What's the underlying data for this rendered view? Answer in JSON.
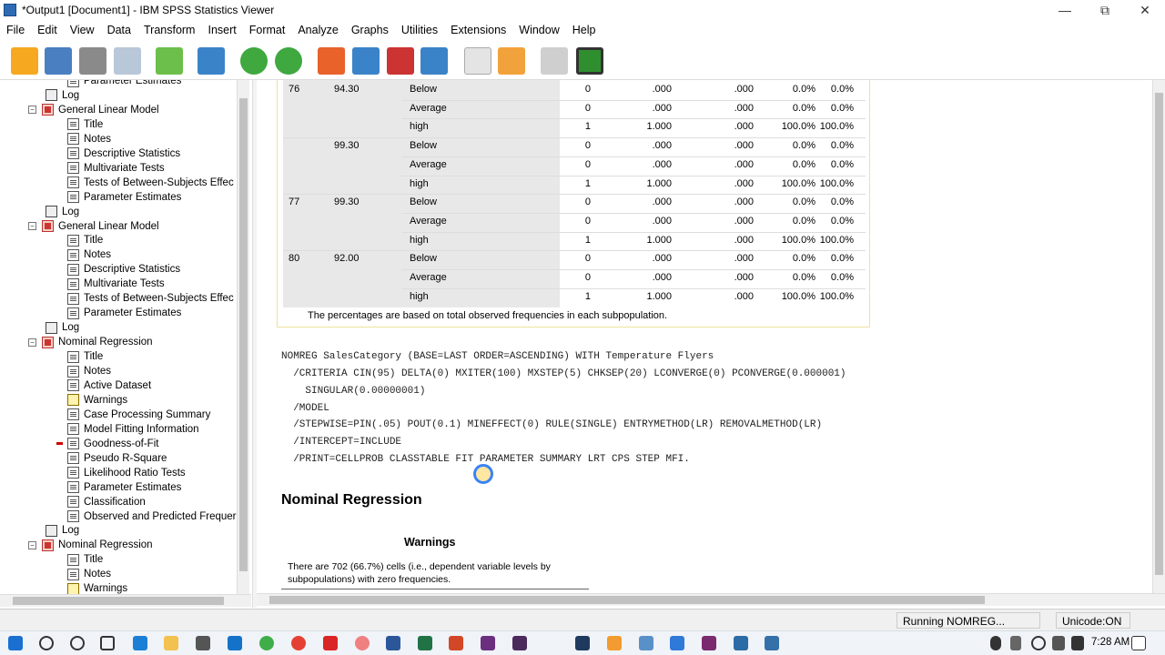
{
  "window": {
    "title": "*Output1 [Document1] - IBM SPSS Statistics Viewer",
    "minimize": "—",
    "restore": "⧉",
    "close": "✕"
  },
  "menu": [
    "File",
    "Edit",
    "View",
    "Data",
    "Transform",
    "Insert",
    "Format",
    "Analyze",
    "Graphs",
    "Utilities",
    "Extensions",
    "Window",
    "Help"
  ],
  "toolbar_icons": [
    "open-folder-icon",
    "save-icon",
    "print-icon",
    "print-preview-icon",
    "export-icon",
    "recall-dialog-icon",
    "undo-icon",
    "redo-icon",
    "goto-data-icon",
    "goto-case-icon",
    "goto-variable-icon",
    "variables-icon",
    "insert-output-icon",
    "insert-text-icon",
    "disabled-icon",
    "add-icon"
  ],
  "tree": [
    {
      "level": 2,
      "icon": "page",
      "label": "Parameter Estimates"
    },
    {
      "level": 1,
      "icon": "log",
      "label": "Log"
    },
    {
      "level": 1,
      "icon": "book",
      "label": "General Linear Model",
      "toggle": "−"
    },
    {
      "level": 2,
      "icon": "page",
      "label": "Title"
    },
    {
      "level": 2,
      "icon": "page",
      "label": "Notes"
    },
    {
      "level": 2,
      "icon": "page",
      "label": "Descriptive Statistics"
    },
    {
      "level": 2,
      "icon": "page",
      "label": "Multivariate Tests"
    },
    {
      "level": 2,
      "icon": "page",
      "label": "Tests of Between-Subjects Effec"
    },
    {
      "level": 2,
      "icon": "page",
      "label": "Parameter Estimates"
    },
    {
      "level": 1,
      "icon": "log",
      "label": "Log"
    },
    {
      "level": 1,
      "icon": "book",
      "label": "General Linear Model",
      "toggle": "−"
    },
    {
      "level": 2,
      "icon": "page",
      "label": "Title"
    },
    {
      "level": 2,
      "icon": "page",
      "label": "Notes"
    },
    {
      "level": 2,
      "icon": "page",
      "label": "Descriptive Statistics"
    },
    {
      "level": 2,
      "icon": "page",
      "label": "Multivariate Tests"
    },
    {
      "level": 2,
      "icon": "page",
      "label": "Tests of Between-Subjects Effec"
    },
    {
      "level": 2,
      "icon": "page",
      "label": "Parameter Estimates"
    },
    {
      "level": 1,
      "icon": "log",
      "label": "Log"
    },
    {
      "level": 1,
      "icon": "book",
      "label": "Nominal Regression",
      "toggle": "−"
    },
    {
      "level": 2,
      "icon": "page",
      "label": "Title"
    },
    {
      "level": 2,
      "icon": "page",
      "label": "Notes"
    },
    {
      "level": 2,
      "icon": "page",
      "label": "Active Dataset"
    },
    {
      "level": 2,
      "icon": "warn",
      "label": "Warnings"
    },
    {
      "level": 2,
      "icon": "page",
      "label": "Case Processing Summary"
    },
    {
      "level": 2,
      "icon": "page",
      "label": "Model Fitting Information"
    },
    {
      "level": 2,
      "icon": "page",
      "label": "Goodness-of-Fit",
      "selected": true
    },
    {
      "level": 2,
      "icon": "page",
      "label": "Pseudo R-Square"
    },
    {
      "level": 2,
      "icon": "page",
      "label": "Likelihood Ratio Tests"
    },
    {
      "level": 2,
      "icon": "page",
      "label": "Parameter Estimates"
    },
    {
      "level": 2,
      "icon": "page",
      "label": "Classification"
    },
    {
      "level": 2,
      "icon": "page",
      "label": "Observed and Predicted Frequer"
    },
    {
      "level": 1,
      "icon": "log",
      "label": "Log"
    },
    {
      "level": 1,
      "icon": "book",
      "label": "Nominal Regression",
      "toggle": "−"
    },
    {
      "level": 2,
      "icon": "page",
      "label": "Title"
    },
    {
      "level": 2,
      "icon": "page",
      "label": "Notes"
    },
    {
      "level": 2,
      "icon": "warn",
      "label": "Warnings"
    }
  ],
  "table": {
    "rows": [
      {
        "a": "76",
        "b": "94.30",
        "c": "Below",
        "n": "0",
        "p1": ".000",
        "p2": ".000",
        "p3": "0.0%",
        "p4": "0.0%"
      },
      {
        "a": "",
        "b": "",
        "c": "Average",
        "n": "0",
        "p1": ".000",
        "p2": ".000",
        "p3": "0.0%",
        "p4": "0.0%"
      },
      {
        "a": "",
        "b": "",
        "c": "high",
        "n": "1",
        "p1": "1.000",
        "p2": ".000",
        "p3": "100.0%",
        "p4": "100.0%"
      },
      {
        "a": "",
        "b": "99.30",
        "c": "Below",
        "n": "0",
        "p1": ".000",
        "p2": ".000",
        "p3": "0.0%",
        "p4": "0.0%"
      },
      {
        "a": "",
        "b": "",
        "c": "Average",
        "n": "0",
        "p1": ".000",
        "p2": ".000",
        "p3": "0.0%",
        "p4": "0.0%"
      },
      {
        "a": "",
        "b": "",
        "c": "high",
        "n": "1",
        "p1": "1.000",
        "p2": ".000",
        "p3": "100.0%",
        "p4": "100.0%"
      },
      {
        "a": "77",
        "b": "99.30",
        "c": "Below",
        "n": "0",
        "p1": ".000",
        "p2": ".000",
        "p3": "0.0%",
        "p4": "0.0%"
      },
      {
        "a": "",
        "b": "",
        "c": "Average",
        "n": "0",
        "p1": ".000",
        "p2": ".000",
        "p3": "0.0%",
        "p4": "0.0%"
      },
      {
        "a": "",
        "b": "",
        "c": "high",
        "n": "1",
        "p1": "1.000",
        "p2": ".000",
        "p3": "100.0%",
        "p4": "100.0%"
      },
      {
        "a": "80",
        "b": "92.00",
        "c": "Below",
        "n": "0",
        "p1": ".000",
        "p2": ".000",
        "p3": "0.0%",
        "p4": "0.0%"
      },
      {
        "a": "",
        "b": "",
        "c": "Average",
        "n": "0",
        "p1": ".000",
        "p2": ".000",
        "p3": "0.0%",
        "p4": "0.0%"
      },
      {
        "a": "",
        "b": "",
        "c": "high",
        "n": "1",
        "p1": "1.000",
        "p2": ".000",
        "p3": "100.0%",
        "p4": "100.0%"
      }
    ],
    "footnote": "The percentages are based on total observed frequencies in each subpopulation."
  },
  "syntax": [
    "NOMREG SalesCategory (BASE=LAST ORDER=ASCENDING) WITH Temperature Flyers",
    "  /CRITERIA CIN(95) DELTA(0) MXITER(100) MXSTEP(5) CHKSEP(20) LCONVERGE(0) PCONVERGE(0.000001)",
    "    SINGULAR(0.00000001)",
    "  /MODEL",
    "  /STEPWISE=PIN(.05) POUT(0.1) MINEFFECT(0) RULE(SINGLE) ENTRYMETHOD(LR) REMOVALMETHOD(LR)",
    "  /INTERCEPT=INCLUDE",
    "  /PRINT=CELLPROB CLASSTABLE FIT PARAMETER SUMMARY LRT CPS STEP MFI."
  ],
  "nominal": {
    "title": "Nominal Regression",
    "warnings_header": "Warnings",
    "warnings_text": "There are 702 (66.7%) cells (i.e., dependent variable levels by subpopulations) with zero frequencies."
  },
  "status": {
    "running": "Running NOMREG...",
    "unicode": "Unicode:ON"
  },
  "clock": "7:28 AM",
  "colors": {
    "accent": "#ff9900",
    "selected_marker": "#d00000",
    "shade": "#e8e8e8"
  }
}
